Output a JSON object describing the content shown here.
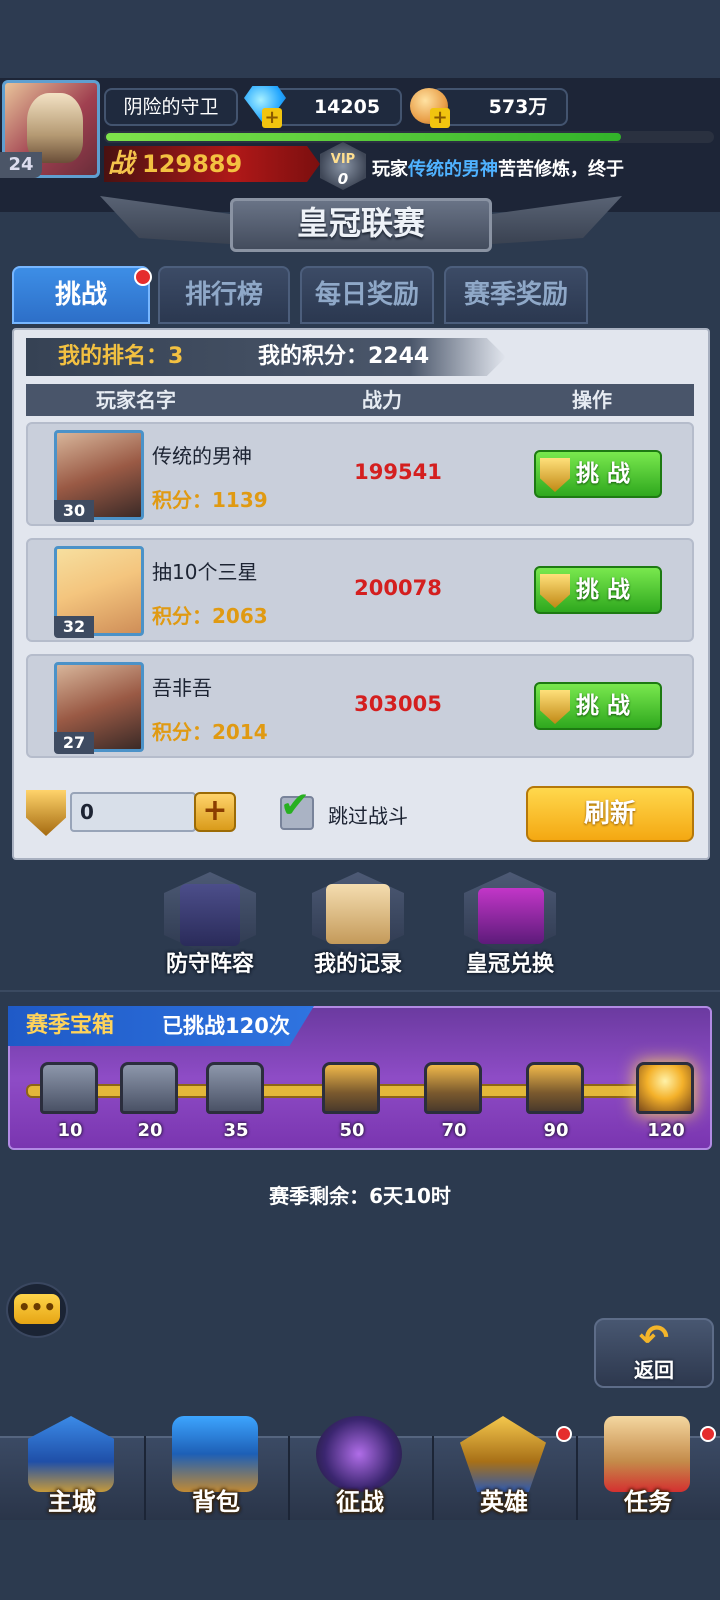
{
  "player": {
    "name": "阴险的守卫",
    "level": "24",
    "gems": "14205",
    "gold": "573万",
    "power_glyph": "战",
    "power": "129889",
    "vip_label": "VIP",
    "vip_level": "0",
    "exp_fraction": 0.85
  },
  "ticker": {
    "prefix": "玩家",
    "highlight": "传统的男神",
    "suffix": "苦苦修炼，终于"
  },
  "title": "皇冠联赛",
  "tabs": [
    {
      "label": "挑战",
      "active": true,
      "has_dot": true
    },
    {
      "label": "排行榜"
    },
    {
      "label": "每日奖励"
    },
    {
      "label": "赛季奖励"
    }
  ],
  "my_rank": "我的排名：3",
  "my_score": "我的积分：2244",
  "columns": [
    "玩家名字",
    "战力",
    "操作"
  ],
  "opponents": [
    {
      "name": "传统的男神",
      "score": "积分：1139",
      "level": "30",
      "power": "199541",
      "button": "挑 战",
      "avatar": "warrior-avatar"
    },
    {
      "name": "抽10个三星",
      "score": "积分：2063",
      "level": "32",
      "power": "200078",
      "button": "挑 战",
      "avatar": "girl-avatar"
    },
    {
      "name": "吾非吾",
      "score": "积分：2014",
      "level": "27",
      "power": "303005",
      "button": "挑 战",
      "avatar": "warrior-avatar"
    }
  ],
  "ticket_count": "0",
  "ticket_plus": "+",
  "skip_battle": {
    "label": "跳过战斗",
    "checked": true,
    "check_glyph": "✔"
  },
  "refresh_label": "刷新",
  "features": [
    {
      "label": "防守阵容",
      "icon": "defense-banner-icon"
    },
    {
      "label": "我的记录",
      "icon": "scroll-icon"
    },
    {
      "label": "皇冠兑换",
      "icon": "gift-box-icon"
    }
  ],
  "season_chest": {
    "title": "赛季宝箱",
    "challenged": "已挑战120次",
    "milestones": [
      {
        "value": "10",
        "state": "opened"
      },
      {
        "value": "20",
        "state": "opened"
      },
      {
        "value": "35",
        "state": "opened"
      },
      {
        "value": "50",
        "state": "gold"
      },
      {
        "value": "70",
        "state": "gold"
      },
      {
        "value": "90",
        "state": "gold"
      },
      {
        "value": "120",
        "state": "claimable"
      }
    ]
  },
  "season_remaining": "赛季剩余：6天10时",
  "chat_glyph": "•••",
  "back": {
    "arrow": "↶",
    "label": "返回"
  },
  "nav": [
    {
      "label": "主城",
      "icon": "castle-icon",
      "dot": false
    },
    {
      "label": "背包",
      "icon": "chest-icon",
      "dot": false
    },
    {
      "label": "征战",
      "icon": "dragon-portal-icon",
      "dot": false
    },
    {
      "label": "英雄",
      "icon": "helmet-icon",
      "dot": true
    },
    {
      "label": "任务",
      "icon": "quest-scroll-icon",
      "dot": true
    }
  ],
  "colors": {
    "accent_blue": "#2d6fc8",
    "score_gold": "#e09a12",
    "power_red": "#d41f1f",
    "challenge_green": "#2fa81e",
    "refresh_orange": "#f4a812"
  }
}
